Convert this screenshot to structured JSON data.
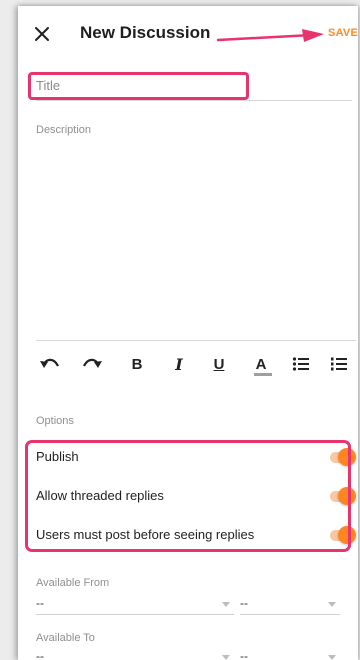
{
  "header": {
    "title": "New Discussion",
    "save_label": "SAVE",
    "close_icon": "close-icon",
    "save_arrow_color": "#e8336c",
    "accent": "#ff8a1f"
  },
  "form": {
    "title_placeholder": "Title",
    "description_label": "Description"
  },
  "toolbar": {
    "undo_icon": "undo-icon",
    "redo_icon": "redo-icon",
    "bold": "B",
    "italic": "I",
    "underline": "U",
    "font_color": "A",
    "bullet_list_icon": "bulleted-list-icon",
    "numbered_list_icon": "numbered-list-icon"
  },
  "options": {
    "heading": "Options",
    "items": [
      {
        "label": "Publish",
        "enabled": true
      },
      {
        "label": "Allow threaded replies",
        "enabled": true
      },
      {
        "label": "Users must post before seeing replies",
        "enabled": true
      }
    ]
  },
  "availability": {
    "from_label": "Available From",
    "to_label": "Available To",
    "from_date": "--",
    "from_time": "--",
    "to_date": "--",
    "to_time": "--"
  }
}
